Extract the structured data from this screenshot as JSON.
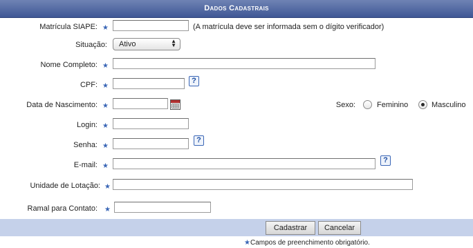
{
  "form": {
    "title": "Dados Cadastrais",
    "siape": {
      "label": "Matrícula SIAPE:",
      "value": "",
      "hint": "(A matrícula deve ser informada sem o dígito verificador)"
    },
    "situacao": {
      "label": "Situação:",
      "selected": "Ativo"
    },
    "nome": {
      "label": "Nome Completo:",
      "value": ""
    },
    "cpf": {
      "label": "CPF:",
      "value": "",
      "help": "?"
    },
    "nascimento": {
      "label": "Data de Nascimento:",
      "value": ""
    },
    "sexo": {
      "label": "Sexo:",
      "options": [
        "Feminino",
        "Masculino"
      ],
      "selected": "Masculino"
    },
    "login": {
      "label": "Login:",
      "value": ""
    },
    "senha": {
      "label": "Senha:",
      "value": "",
      "help": "?"
    },
    "email": {
      "label": "E-mail:",
      "value": "",
      "help": "?"
    },
    "lotacao": {
      "label": "Unidade de Lotação:",
      "value": ""
    },
    "ramal": {
      "label": "Ramal para Contato:",
      "value": ""
    }
  },
  "actions": {
    "submit": "Cadastrar",
    "cancel": "Cancelar"
  },
  "footnote": {
    "star": "★",
    "text": "Campos de preenchimento obrigatório."
  },
  "icons": {
    "required": "star-icon",
    "help": "help-icon",
    "date": "calendar-icon"
  },
  "colors": {
    "header": "#3f5795",
    "footer_bar": "#c5d1ea",
    "required_star": "#3a66b6"
  }
}
